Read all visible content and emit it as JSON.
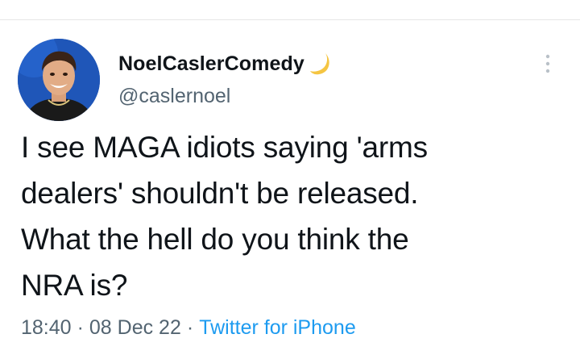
{
  "author": {
    "display_name": "NoelCaslerComedy",
    "handle": "@caslernoel",
    "name_emoji_icon": "crescent-moon-icon"
  },
  "tweet": {
    "lines": [
      "I see MAGA idiots saying 'arms",
      "dealers' shouldn't be released.",
      "What the hell do you think the",
      "NRA is?"
    ]
  },
  "meta": {
    "time": "18:40",
    "date": "08 Dec 22",
    "separator": "·",
    "source": "Twitter for iPhone"
  },
  "colors": {
    "text": "#0f1419",
    "secondary": "#536471",
    "link": "#1d9bf0",
    "moon": "#f5c542"
  }
}
